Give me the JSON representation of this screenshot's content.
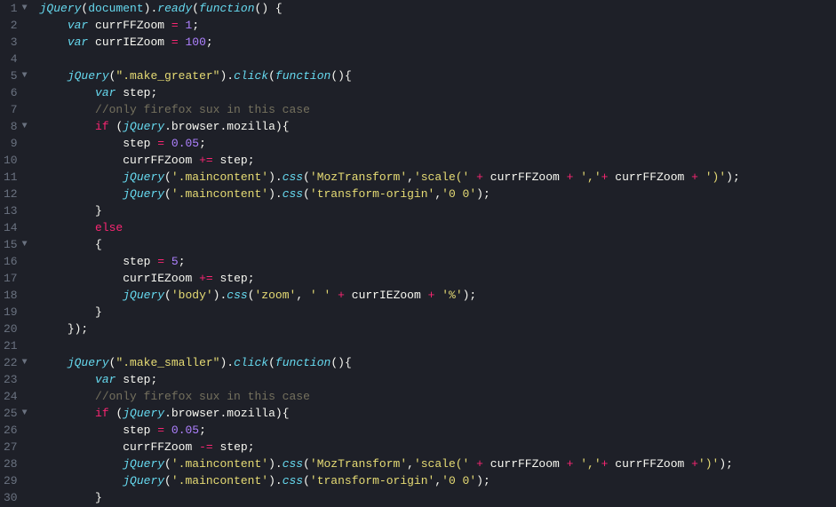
{
  "lines": [
    {
      "num": "1",
      "fold": true,
      "tokens": [
        {
          "t": "jquery",
          "v": "jQuery"
        },
        {
          "t": "punct",
          "v": "("
        },
        {
          "t": "builtin",
          "v": "document"
        },
        {
          "t": "punct",
          "v": ")."
        },
        {
          "t": "func",
          "v": "ready"
        },
        {
          "t": "punct",
          "v": "("
        },
        {
          "t": "storage",
          "v": "function"
        },
        {
          "t": "punct",
          "v": "() {"
        }
      ]
    },
    {
      "num": "2",
      "fold": false,
      "tokens": [
        {
          "t": "indent",
          "v": "    "
        },
        {
          "t": "storage",
          "v": "var"
        },
        {
          "t": "punct",
          "v": " "
        },
        {
          "t": "var",
          "v": "currFFZoom"
        },
        {
          "t": "punct",
          "v": " "
        },
        {
          "t": "operator",
          "v": "="
        },
        {
          "t": "punct",
          "v": " "
        },
        {
          "t": "number",
          "v": "1"
        },
        {
          "t": "punct",
          "v": ";"
        }
      ]
    },
    {
      "num": "3",
      "fold": false,
      "tokens": [
        {
          "t": "indent",
          "v": "    "
        },
        {
          "t": "storage",
          "v": "var"
        },
        {
          "t": "punct",
          "v": " "
        },
        {
          "t": "var",
          "v": "currIEZoom"
        },
        {
          "t": "punct",
          "v": " "
        },
        {
          "t": "operator",
          "v": "="
        },
        {
          "t": "punct",
          "v": " "
        },
        {
          "t": "number",
          "v": "100"
        },
        {
          "t": "punct",
          "v": ";"
        }
      ]
    },
    {
      "num": "4",
      "fold": false,
      "tokens": []
    },
    {
      "num": "5",
      "fold": true,
      "tokens": [
        {
          "t": "indent",
          "v": "    "
        },
        {
          "t": "jquery",
          "v": "jQuery"
        },
        {
          "t": "punct",
          "v": "("
        },
        {
          "t": "string",
          "v": "\".make_greater\""
        },
        {
          "t": "punct",
          "v": ")."
        },
        {
          "t": "func",
          "v": "click"
        },
        {
          "t": "punct",
          "v": "("
        },
        {
          "t": "storage",
          "v": "function"
        },
        {
          "t": "punct",
          "v": "(){"
        }
      ]
    },
    {
      "num": "6",
      "fold": false,
      "tokens": [
        {
          "t": "indent",
          "v": "        "
        },
        {
          "t": "storage",
          "v": "var"
        },
        {
          "t": "punct",
          "v": " "
        },
        {
          "t": "var",
          "v": "step"
        },
        {
          "t": "punct",
          "v": ";"
        }
      ]
    },
    {
      "num": "7",
      "fold": false,
      "tokens": [
        {
          "t": "indent",
          "v": "        "
        },
        {
          "t": "comment",
          "v": "//only firefox sux in this case"
        }
      ]
    },
    {
      "num": "8",
      "fold": true,
      "tokens": [
        {
          "t": "indent",
          "v": "        "
        },
        {
          "t": "keyword",
          "v": "if"
        },
        {
          "t": "punct",
          "v": " ("
        },
        {
          "t": "jquery",
          "v": "jQuery"
        },
        {
          "t": "punct",
          "v": "."
        },
        {
          "t": "var",
          "v": "browser"
        },
        {
          "t": "punct",
          "v": "."
        },
        {
          "t": "var",
          "v": "mozilla"
        },
        {
          "t": "punct",
          "v": "){"
        }
      ]
    },
    {
      "num": "9",
      "fold": false,
      "tokens": [
        {
          "t": "indent",
          "v": "            "
        },
        {
          "t": "var",
          "v": "step"
        },
        {
          "t": "punct",
          "v": " "
        },
        {
          "t": "operator",
          "v": "="
        },
        {
          "t": "punct",
          "v": " "
        },
        {
          "t": "number",
          "v": "0.05"
        },
        {
          "t": "punct",
          "v": ";"
        }
      ]
    },
    {
      "num": "10",
      "fold": false,
      "tokens": [
        {
          "t": "indent",
          "v": "            "
        },
        {
          "t": "var",
          "v": "currFFZoom"
        },
        {
          "t": "punct",
          "v": " "
        },
        {
          "t": "operator",
          "v": "+="
        },
        {
          "t": "punct",
          "v": " "
        },
        {
          "t": "var",
          "v": "step"
        },
        {
          "t": "punct",
          "v": ";"
        }
      ]
    },
    {
      "num": "11",
      "fold": false,
      "tokens": [
        {
          "t": "indent",
          "v": "            "
        },
        {
          "t": "jquery",
          "v": "jQuery"
        },
        {
          "t": "punct",
          "v": "("
        },
        {
          "t": "string",
          "v": "'.maincontent'"
        },
        {
          "t": "punct",
          "v": ")."
        },
        {
          "t": "func",
          "v": "css"
        },
        {
          "t": "punct",
          "v": "("
        },
        {
          "t": "string",
          "v": "'MozTransform'"
        },
        {
          "t": "punct",
          "v": ","
        },
        {
          "t": "string",
          "v": "'scale('"
        },
        {
          "t": "punct",
          "v": " "
        },
        {
          "t": "operator",
          "v": "+"
        },
        {
          "t": "punct",
          "v": " "
        },
        {
          "t": "var",
          "v": "currFFZoom"
        },
        {
          "t": "punct",
          "v": " "
        },
        {
          "t": "operator",
          "v": "+"
        },
        {
          "t": "punct",
          "v": " "
        },
        {
          "t": "string",
          "v": "','"
        },
        {
          "t": "operator",
          "v": "+"
        },
        {
          "t": "punct",
          "v": " "
        },
        {
          "t": "var",
          "v": "currFFZoom"
        },
        {
          "t": "punct",
          "v": " "
        },
        {
          "t": "operator",
          "v": "+"
        },
        {
          "t": "punct",
          "v": " "
        },
        {
          "t": "string",
          "v": "')'"
        },
        {
          "t": "punct",
          "v": ");"
        }
      ]
    },
    {
      "num": "12",
      "fold": false,
      "tokens": [
        {
          "t": "indent",
          "v": "            "
        },
        {
          "t": "jquery",
          "v": "jQuery"
        },
        {
          "t": "punct",
          "v": "("
        },
        {
          "t": "string",
          "v": "'.maincontent'"
        },
        {
          "t": "punct",
          "v": ")."
        },
        {
          "t": "func",
          "v": "css"
        },
        {
          "t": "punct",
          "v": "("
        },
        {
          "t": "string",
          "v": "'transform-origin'"
        },
        {
          "t": "punct",
          "v": ","
        },
        {
          "t": "string",
          "v": "'0 0'"
        },
        {
          "t": "punct",
          "v": ");"
        }
      ]
    },
    {
      "num": "13",
      "fold": false,
      "tokens": [
        {
          "t": "indent",
          "v": "        "
        },
        {
          "t": "punct",
          "v": "}"
        }
      ]
    },
    {
      "num": "14",
      "fold": false,
      "tokens": [
        {
          "t": "indent",
          "v": "        "
        },
        {
          "t": "keyword",
          "v": "else"
        }
      ]
    },
    {
      "num": "15",
      "fold": true,
      "tokens": [
        {
          "t": "indent",
          "v": "        "
        },
        {
          "t": "punct",
          "v": "{"
        }
      ]
    },
    {
      "num": "16",
      "fold": false,
      "tokens": [
        {
          "t": "indent",
          "v": "            "
        },
        {
          "t": "var",
          "v": "step"
        },
        {
          "t": "punct",
          "v": " "
        },
        {
          "t": "operator",
          "v": "="
        },
        {
          "t": "punct",
          "v": " "
        },
        {
          "t": "number",
          "v": "5"
        },
        {
          "t": "punct",
          "v": ";"
        }
      ]
    },
    {
      "num": "17",
      "fold": false,
      "tokens": [
        {
          "t": "indent",
          "v": "            "
        },
        {
          "t": "var",
          "v": "currIEZoom"
        },
        {
          "t": "punct",
          "v": " "
        },
        {
          "t": "operator",
          "v": "+="
        },
        {
          "t": "punct",
          "v": " "
        },
        {
          "t": "var",
          "v": "step"
        },
        {
          "t": "punct",
          "v": ";"
        }
      ]
    },
    {
      "num": "18",
      "fold": false,
      "tokens": [
        {
          "t": "indent",
          "v": "            "
        },
        {
          "t": "jquery",
          "v": "jQuery"
        },
        {
          "t": "punct",
          "v": "("
        },
        {
          "t": "string",
          "v": "'body'"
        },
        {
          "t": "punct",
          "v": ")."
        },
        {
          "t": "func",
          "v": "css"
        },
        {
          "t": "punct",
          "v": "("
        },
        {
          "t": "string",
          "v": "'zoom'"
        },
        {
          "t": "punct",
          "v": ", "
        },
        {
          "t": "string",
          "v": "' '"
        },
        {
          "t": "punct",
          "v": " "
        },
        {
          "t": "operator",
          "v": "+"
        },
        {
          "t": "punct",
          "v": " "
        },
        {
          "t": "var",
          "v": "currIEZoom"
        },
        {
          "t": "punct",
          "v": " "
        },
        {
          "t": "operator",
          "v": "+"
        },
        {
          "t": "punct",
          "v": " "
        },
        {
          "t": "string",
          "v": "'%'"
        },
        {
          "t": "punct",
          "v": ");"
        }
      ]
    },
    {
      "num": "19",
      "fold": false,
      "tokens": [
        {
          "t": "indent",
          "v": "        "
        },
        {
          "t": "punct",
          "v": "}"
        }
      ]
    },
    {
      "num": "20",
      "fold": false,
      "tokens": [
        {
          "t": "indent",
          "v": "    "
        },
        {
          "t": "punct",
          "v": "});"
        }
      ]
    },
    {
      "num": "21",
      "fold": false,
      "tokens": []
    },
    {
      "num": "22",
      "fold": true,
      "tokens": [
        {
          "t": "indent",
          "v": "    "
        },
        {
          "t": "jquery",
          "v": "jQuery"
        },
        {
          "t": "punct",
          "v": "("
        },
        {
          "t": "string",
          "v": "\".make_smaller\""
        },
        {
          "t": "punct",
          "v": ")."
        },
        {
          "t": "func",
          "v": "click"
        },
        {
          "t": "punct",
          "v": "("
        },
        {
          "t": "storage",
          "v": "function"
        },
        {
          "t": "punct",
          "v": "(){"
        }
      ]
    },
    {
      "num": "23",
      "fold": false,
      "tokens": [
        {
          "t": "indent",
          "v": "        "
        },
        {
          "t": "storage",
          "v": "var"
        },
        {
          "t": "punct",
          "v": " "
        },
        {
          "t": "var",
          "v": "step"
        },
        {
          "t": "punct",
          "v": ";"
        }
      ]
    },
    {
      "num": "24",
      "fold": false,
      "tokens": [
        {
          "t": "indent",
          "v": "        "
        },
        {
          "t": "comment",
          "v": "//only firefox sux in this case"
        }
      ]
    },
    {
      "num": "25",
      "fold": true,
      "tokens": [
        {
          "t": "indent",
          "v": "        "
        },
        {
          "t": "keyword",
          "v": "if"
        },
        {
          "t": "punct",
          "v": " ("
        },
        {
          "t": "jquery",
          "v": "jQuery"
        },
        {
          "t": "punct",
          "v": "."
        },
        {
          "t": "var",
          "v": "browser"
        },
        {
          "t": "punct",
          "v": "."
        },
        {
          "t": "var",
          "v": "mozilla"
        },
        {
          "t": "punct",
          "v": "){"
        }
      ]
    },
    {
      "num": "26",
      "fold": false,
      "tokens": [
        {
          "t": "indent",
          "v": "            "
        },
        {
          "t": "var",
          "v": "step"
        },
        {
          "t": "punct",
          "v": " "
        },
        {
          "t": "operator",
          "v": "="
        },
        {
          "t": "punct",
          "v": " "
        },
        {
          "t": "number",
          "v": "0.05"
        },
        {
          "t": "punct",
          "v": ";"
        }
      ]
    },
    {
      "num": "27",
      "fold": false,
      "tokens": [
        {
          "t": "indent",
          "v": "            "
        },
        {
          "t": "var",
          "v": "currFFZoom"
        },
        {
          "t": "punct",
          "v": " "
        },
        {
          "t": "operator",
          "v": "-="
        },
        {
          "t": "punct",
          "v": " "
        },
        {
          "t": "var",
          "v": "step"
        },
        {
          "t": "punct",
          "v": ";"
        }
      ]
    },
    {
      "num": "28",
      "fold": false,
      "tokens": [
        {
          "t": "indent",
          "v": "            "
        },
        {
          "t": "jquery",
          "v": "jQuery"
        },
        {
          "t": "punct",
          "v": "("
        },
        {
          "t": "string",
          "v": "'.maincontent'"
        },
        {
          "t": "punct",
          "v": ")."
        },
        {
          "t": "func",
          "v": "css"
        },
        {
          "t": "punct",
          "v": "("
        },
        {
          "t": "string",
          "v": "'MozTransform'"
        },
        {
          "t": "punct",
          "v": ","
        },
        {
          "t": "string",
          "v": "'scale('"
        },
        {
          "t": "punct",
          "v": " "
        },
        {
          "t": "operator",
          "v": "+"
        },
        {
          "t": "punct",
          "v": " "
        },
        {
          "t": "var",
          "v": "currFFZoom"
        },
        {
          "t": "punct",
          "v": " "
        },
        {
          "t": "operator",
          "v": "+"
        },
        {
          "t": "punct",
          "v": " "
        },
        {
          "t": "string",
          "v": "','"
        },
        {
          "t": "operator",
          "v": "+"
        },
        {
          "t": "punct",
          "v": " "
        },
        {
          "t": "var",
          "v": "currFFZoom"
        },
        {
          "t": "punct",
          "v": " "
        },
        {
          "t": "operator",
          "v": "+"
        },
        {
          "t": "string",
          "v": "')'"
        },
        {
          "t": "punct",
          "v": ");"
        }
      ]
    },
    {
      "num": "29",
      "fold": false,
      "tokens": [
        {
          "t": "indent",
          "v": "            "
        },
        {
          "t": "jquery",
          "v": "jQuery"
        },
        {
          "t": "punct",
          "v": "("
        },
        {
          "t": "string",
          "v": "'.maincontent'"
        },
        {
          "t": "punct",
          "v": ")."
        },
        {
          "t": "func",
          "v": "css"
        },
        {
          "t": "punct",
          "v": "("
        },
        {
          "t": "string",
          "v": "'transform-origin'"
        },
        {
          "t": "punct",
          "v": ","
        },
        {
          "t": "string",
          "v": "'0 0'"
        },
        {
          "t": "punct",
          "v": ");"
        }
      ]
    },
    {
      "num": "30",
      "fold": false,
      "tokens": [
        {
          "t": "indent",
          "v": "        "
        },
        {
          "t": "punct",
          "v": "}"
        }
      ]
    }
  ]
}
